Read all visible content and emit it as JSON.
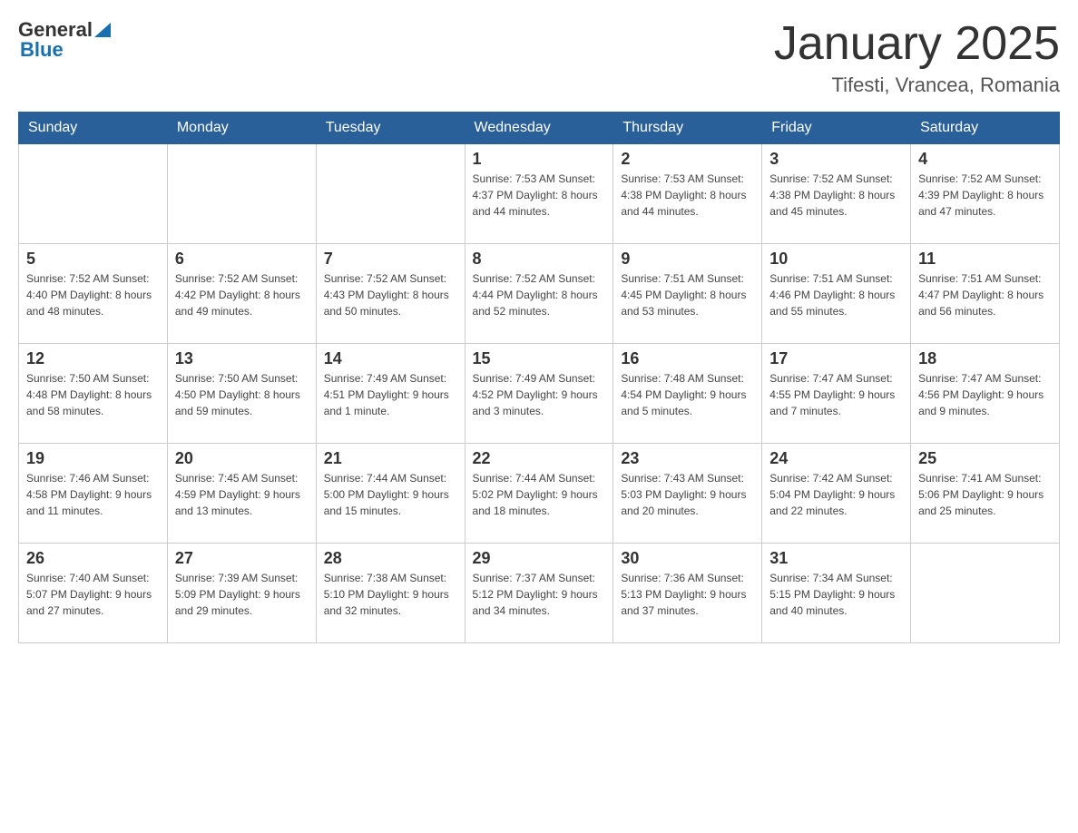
{
  "header": {
    "logo_general": "General",
    "logo_blue": "Blue",
    "month_title": "January 2025",
    "location": "Tifesti, Vrancea, Romania"
  },
  "days_of_week": [
    "Sunday",
    "Monday",
    "Tuesday",
    "Wednesday",
    "Thursday",
    "Friday",
    "Saturday"
  ],
  "weeks": [
    [
      {
        "day": "",
        "info": ""
      },
      {
        "day": "",
        "info": ""
      },
      {
        "day": "",
        "info": ""
      },
      {
        "day": "1",
        "info": "Sunrise: 7:53 AM\nSunset: 4:37 PM\nDaylight: 8 hours\nand 44 minutes."
      },
      {
        "day": "2",
        "info": "Sunrise: 7:53 AM\nSunset: 4:38 PM\nDaylight: 8 hours\nand 44 minutes."
      },
      {
        "day": "3",
        "info": "Sunrise: 7:52 AM\nSunset: 4:38 PM\nDaylight: 8 hours\nand 45 minutes."
      },
      {
        "day": "4",
        "info": "Sunrise: 7:52 AM\nSunset: 4:39 PM\nDaylight: 8 hours\nand 47 minutes."
      }
    ],
    [
      {
        "day": "5",
        "info": "Sunrise: 7:52 AM\nSunset: 4:40 PM\nDaylight: 8 hours\nand 48 minutes."
      },
      {
        "day": "6",
        "info": "Sunrise: 7:52 AM\nSunset: 4:42 PM\nDaylight: 8 hours\nand 49 minutes."
      },
      {
        "day": "7",
        "info": "Sunrise: 7:52 AM\nSunset: 4:43 PM\nDaylight: 8 hours\nand 50 minutes."
      },
      {
        "day": "8",
        "info": "Sunrise: 7:52 AM\nSunset: 4:44 PM\nDaylight: 8 hours\nand 52 minutes."
      },
      {
        "day": "9",
        "info": "Sunrise: 7:51 AM\nSunset: 4:45 PM\nDaylight: 8 hours\nand 53 minutes."
      },
      {
        "day": "10",
        "info": "Sunrise: 7:51 AM\nSunset: 4:46 PM\nDaylight: 8 hours\nand 55 minutes."
      },
      {
        "day": "11",
        "info": "Sunrise: 7:51 AM\nSunset: 4:47 PM\nDaylight: 8 hours\nand 56 minutes."
      }
    ],
    [
      {
        "day": "12",
        "info": "Sunrise: 7:50 AM\nSunset: 4:48 PM\nDaylight: 8 hours\nand 58 minutes."
      },
      {
        "day": "13",
        "info": "Sunrise: 7:50 AM\nSunset: 4:50 PM\nDaylight: 8 hours\nand 59 minutes."
      },
      {
        "day": "14",
        "info": "Sunrise: 7:49 AM\nSunset: 4:51 PM\nDaylight: 9 hours\nand 1 minute."
      },
      {
        "day": "15",
        "info": "Sunrise: 7:49 AM\nSunset: 4:52 PM\nDaylight: 9 hours\nand 3 minutes."
      },
      {
        "day": "16",
        "info": "Sunrise: 7:48 AM\nSunset: 4:54 PM\nDaylight: 9 hours\nand 5 minutes."
      },
      {
        "day": "17",
        "info": "Sunrise: 7:47 AM\nSunset: 4:55 PM\nDaylight: 9 hours\nand 7 minutes."
      },
      {
        "day": "18",
        "info": "Sunrise: 7:47 AM\nSunset: 4:56 PM\nDaylight: 9 hours\nand 9 minutes."
      }
    ],
    [
      {
        "day": "19",
        "info": "Sunrise: 7:46 AM\nSunset: 4:58 PM\nDaylight: 9 hours\nand 11 minutes."
      },
      {
        "day": "20",
        "info": "Sunrise: 7:45 AM\nSunset: 4:59 PM\nDaylight: 9 hours\nand 13 minutes."
      },
      {
        "day": "21",
        "info": "Sunrise: 7:44 AM\nSunset: 5:00 PM\nDaylight: 9 hours\nand 15 minutes."
      },
      {
        "day": "22",
        "info": "Sunrise: 7:44 AM\nSunset: 5:02 PM\nDaylight: 9 hours\nand 18 minutes."
      },
      {
        "day": "23",
        "info": "Sunrise: 7:43 AM\nSunset: 5:03 PM\nDaylight: 9 hours\nand 20 minutes."
      },
      {
        "day": "24",
        "info": "Sunrise: 7:42 AM\nSunset: 5:04 PM\nDaylight: 9 hours\nand 22 minutes."
      },
      {
        "day": "25",
        "info": "Sunrise: 7:41 AM\nSunset: 5:06 PM\nDaylight: 9 hours\nand 25 minutes."
      }
    ],
    [
      {
        "day": "26",
        "info": "Sunrise: 7:40 AM\nSunset: 5:07 PM\nDaylight: 9 hours\nand 27 minutes."
      },
      {
        "day": "27",
        "info": "Sunrise: 7:39 AM\nSunset: 5:09 PM\nDaylight: 9 hours\nand 29 minutes."
      },
      {
        "day": "28",
        "info": "Sunrise: 7:38 AM\nSunset: 5:10 PM\nDaylight: 9 hours\nand 32 minutes."
      },
      {
        "day": "29",
        "info": "Sunrise: 7:37 AM\nSunset: 5:12 PM\nDaylight: 9 hours\nand 34 minutes."
      },
      {
        "day": "30",
        "info": "Sunrise: 7:36 AM\nSunset: 5:13 PM\nDaylight: 9 hours\nand 37 minutes."
      },
      {
        "day": "31",
        "info": "Sunrise: 7:34 AM\nSunset: 5:15 PM\nDaylight: 9 hours\nand 40 minutes."
      },
      {
        "day": "",
        "info": ""
      }
    ]
  ]
}
